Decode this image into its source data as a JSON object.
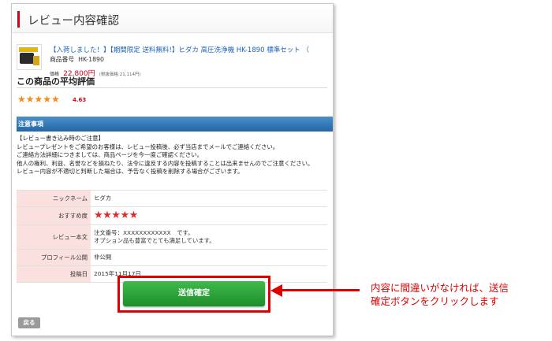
{
  "header": {
    "title": "レビュー内容確認"
  },
  "product": {
    "image_icon": "pressure-washer-thumbnail",
    "name": "【入荷しました！】【期間限定 送料無料!】ヒダカ 高圧洗浄機 HK-1890 標準セット （",
    "code_label": "商品番号",
    "code": "HK-1890",
    "price_label": "価格",
    "price": "22,800円",
    "tax_note": "(税抜価格:21,114円)"
  },
  "average": {
    "title": "この商品の平均評価",
    "stars": "★★★★★",
    "score": "4.63"
  },
  "notice": {
    "bar_label": "注意事項",
    "lines": [
      "【レビュー書き込み時のご注意】",
      "レビュープレゼントをご希望のお客様は、レビュー投稿後、必ず当店までメールでご連絡ください。",
      "ご連絡方法詳細につきましては、商品ページを今一度ご確認ください。",
      "他人の権利、利益、名誉などを損ねたり、法令に違反する内容を投稿することは出来ませんのでご注意ください。",
      "レビュー内容が不適切と判断した場合は、予告なく投稿を削除する場合がございます。"
    ]
  },
  "review": {
    "nickname_label": "ニックネーム",
    "nickname": "ヒダカ",
    "rating_label": "おすすめ度",
    "rating": "★★★★★",
    "body_label": "レビュー本文",
    "body_line1": "注文番号：XXXXXXXXXXXX　です。",
    "body_line2": "オプション品も豊富でとても満足しています。",
    "profile_label": "プロフィール公開",
    "profile": "非公開",
    "date_label": "投稿日",
    "date": "2015年11月17日"
  },
  "actions": {
    "submit_label": "送信確定",
    "back_label": "戻る"
  },
  "callout": {
    "line1": "内容に間違いがなければ、送信",
    "line2": "確定ボタンをクリックします"
  },
  "colors": {
    "accent": "#d0021b",
    "notice_bar": "#2f74b5",
    "submit": "#2a9d36",
    "highlight": "#e00000"
  }
}
